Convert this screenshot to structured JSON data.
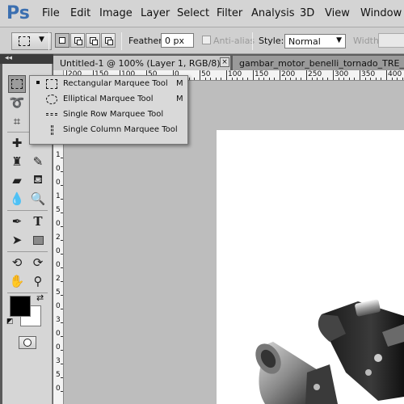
{
  "app": {
    "logo": "Ps"
  },
  "menubar": {
    "items": [
      "File",
      "Edit",
      "Image",
      "Layer",
      "Select",
      "Filter",
      "Analysis",
      "3D",
      "View",
      "Window"
    ]
  },
  "options_bar": {
    "feather_label": "Feather:",
    "feather_value": "0 px",
    "antialias_label": "Anti-alias",
    "style_label": "Style:",
    "style_value": "Normal",
    "width_label": "Width:"
  },
  "tabs": [
    {
      "label": "Untitled-1 @ 100% (Layer 1, RGB/8) *",
      "active": true
    },
    {
      "label": "gambar_motor_benelli_tornado_TRE_LE",
      "active": false
    }
  ],
  "tab_close_icon": "×",
  "ruler_top_labels": [
    "200",
    "150",
    "100",
    "50",
    "0",
    "50",
    "100",
    "150",
    "200",
    "250",
    "300",
    "350",
    "400",
    "450"
  ],
  "ruler_left_labels": [
    "2",
    "5",
    "0",
    "5",
    "0",
    "1",
    "0",
    "0",
    "1",
    "5",
    "0",
    "2",
    "0",
    "0",
    "2",
    "5",
    "0",
    "3",
    "0",
    "0",
    "3",
    "5",
    "0"
  ],
  "flyout": {
    "items": [
      {
        "icon": "rectangular-marquee-icon",
        "label": "Rectangular Marquee Tool",
        "key": "M",
        "selected": true
      },
      {
        "icon": "elliptical-marquee-icon",
        "label": "Elliptical Marquee Tool",
        "key": "M",
        "selected": false
      },
      {
        "icon": "single-row-marquee-icon",
        "label": "Single Row Marquee Tool",
        "key": "",
        "selected": false
      },
      {
        "icon": "single-column-marquee-icon",
        "label": "Single Column Marquee Tool",
        "key": "",
        "selected": false
      }
    ]
  },
  "tools": [
    "rectangular-marquee-icon",
    "lasso-icon",
    "crop-icon",
    "healing-brush-icon",
    "brush-icon",
    "clone-stamp-icon",
    "history-brush-icon",
    "eraser-icon",
    "paint-bucket-icon",
    "blur-icon",
    "dodge-icon",
    "pen-icon",
    "type-icon",
    "path-selection-icon",
    "rectangle-shape-icon",
    "3d-rotate-icon",
    "3d-orbit-icon",
    "hand-icon",
    "zoom-icon"
  ],
  "colors": {
    "foreground": "#000000",
    "background": "#ffffff",
    "accent": "#3b6fb0"
  }
}
